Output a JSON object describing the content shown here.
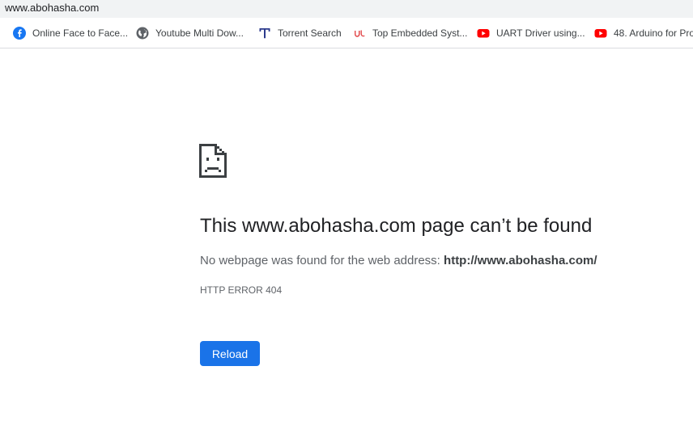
{
  "address_bar": {
    "url": "www.abohasha.com"
  },
  "bookmarks": [
    {
      "label": "Online Face to Face...",
      "icon": "facebook-icon"
    },
    {
      "label": "Youtube Multi Dow...",
      "icon": "globe-icon"
    },
    {
      "label": "Torrent Search",
      "icon": "torrent-t-icon"
    },
    {
      "label": "Top Embedded Syst...",
      "icon": "udemy-icon"
    },
    {
      "label": "UART Driver using...",
      "icon": "youtube-icon"
    },
    {
      "label": "48. Arduino for Pro",
      "icon": "youtube-icon"
    }
  ],
  "error_page": {
    "icon": "sad-page-icon",
    "title": "This www.abohasha.com page can’t be found",
    "description_prefix": "No webpage was found for the web address: ",
    "address": "http://www.abohasha.com/",
    "error_code": "HTTP ERROR 404",
    "reload_label": "Reload"
  },
  "colors": {
    "accent": "#1a73e8",
    "youtube_red": "#ff0000",
    "facebook_blue": "#1877f2",
    "udemy_red": "#e2494b",
    "torrent_navy": "#2b3a8c"
  }
}
